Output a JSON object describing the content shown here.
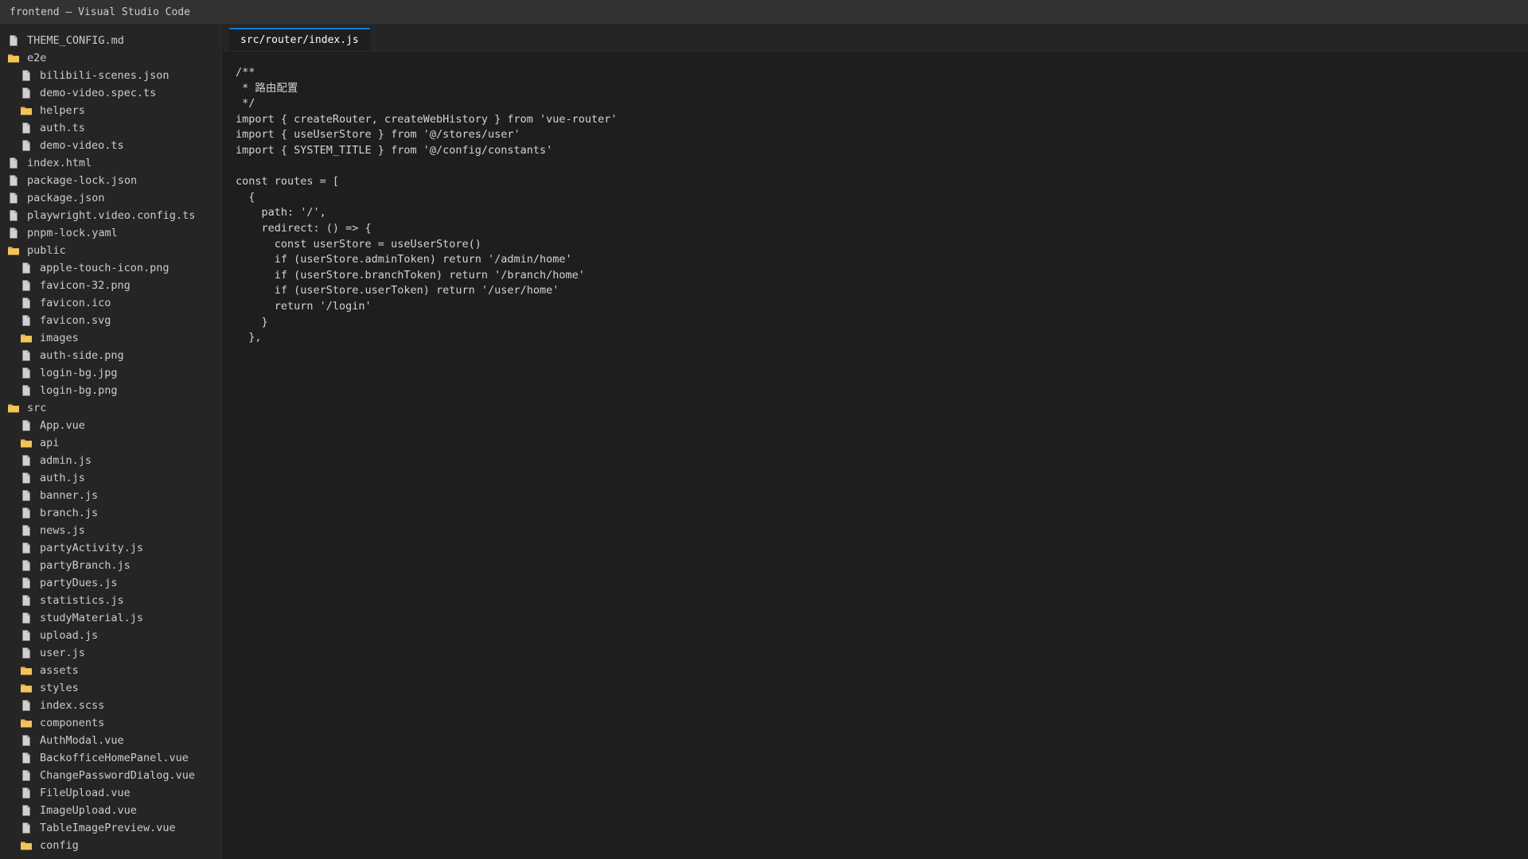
{
  "window": {
    "title": "frontend — Visual Studio Code"
  },
  "explorer": {
    "items": [
      {
        "label": "THEME_CONFIG.md",
        "type": "file",
        "depth": 0
      },
      {
        "label": "e2e",
        "type": "folder",
        "depth": 0
      },
      {
        "label": "bilibili-scenes.json",
        "type": "file",
        "depth": 1
      },
      {
        "label": "demo-video.spec.ts",
        "type": "file",
        "depth": 1
      },
      {
        "label": "helpers",
        "type": "folder",
        "depth": 1
      },
      {
        "label": "auth.ts",
        "type": "file",
        "depth": 1
      },
      {
        "label": "demo-video.ts",
        "type": "file",
        "depth": 1
      },
      {
        "label": "index.html",
        "type": "file",
        "depth": 0
      },
      {
        "label": "package-lock.json",
        "type": "file",
        "depth": 0
      },
      {
        "label": "package.json",
        "type": "file",
        "depth": 0
      },
      {
        "label": "playwright.video.config.ts",
        "type": "file",
        "depth": 0
      },
      {
        "label": "pnpm-lock.yaml",
        "type": "file",
        "depth": 0
      },
      {
        "label": "public",
        "type": "folder",
        "depth": 0
      },
      {
        "label": "apple-touch-icon.png",
        "type": "file",
        "depth": 1
      },
      {
        "label": "favicon-32.png",
        "type": "file",
        "depth": 1
      },
      {
        "label": "favicon.ico",
        "type": "file",
        "depth": 1
      },
      {
        "label": "favicon.svg",
        "type": "file",
        "depth": 1
      },
      {
        "label": "images",
        "type": "folder",
        "depth": 1
      },
      {
        "label": "auth-side.png",
        "type": "file",
        "depth": 1
      },
      {
        "label": "login-bg.jpg",
        "type": "file",
        "depth": 1
      },
      {
        "label": "login-bg.png",
        "type": "file",
        "depth": 1
      },
      {
        "label": "src",
        "type": "folder",
        "depth": 0
      },
      {
        "label": "App.vue",
        "type": "file",
        "depth": 1
      },
      {
        "label": "api",
        "type": "folder",
        "depth": 1
      },
      {
        "label": "admin.js",
        "type": "file",
        "depth": 1
      },
      {
        "label": "auth.js",
        "type": "file",
        "depth": 1
      },
      {
        "label": "banner.js",
        "type": "file",
        "depth": 1
      },
      {
        "label": "branch.js",
        "type": "file",
        "depth": 1
      },
      {
        "label": "news.js",
        "type": "file",
        "depth": 1
      },
      {
        "label": "partyActivity.js",
        "type": "file",
        "depth": 1
      },
      {
        "label": "partyBranch.js",
        "type": "file",
        "depth": 1
      },
      {
        "label": "partyDues.js",
        "type": "file",
        "depth": 1
      },
      {
        "label": "statistics.js",
        "type": "file",
        "depth": 1
      },
      {
        "label": "studyMaterial.js",
        "type": "file",
        "depth": 1
      },
      {
        "label": "upload.js",
        "type": "file",
        "depth": 1
      },
      {
        "label": "user.js",
        "type": "file",
        "depth": 1
      },
      {
        "label": "assets",
        "type": "folder",
        "depth": 1
      },
      {
        "label": "styles",
        "type": "folder",
        "depth": 1
      },
      {
        "label": "index.scss",
        "type": "file",
        "depth": 1
      },
      {
        "label": "components",
        "type": "folder",
        "depth": 1
      },
      {
        "label": "AuthModal.vue",
        "type": "file",
        "depth": 1
      },
      {
        "label": "BackofficeHomePanel.vue",
        "type": "file",
        "depth": 1
      },
      {
        "label": "ChangePasswordDialog.vue",
        "type": "file",
        "depth": 1
      },
      {
        "label": "FileUpload.vue",
        "type": "file",
        "depth": 1
      },
      {
        "label": "ImageUpload.vue",
        "type": "file",
        "depth": 1
      },
      {
        "label": "TableImagePreview.vue",
        "type": "file",
        "depth": 1
      },
      {
        "label": "config",
        "type": "folder",
        "depth": 1
      }
    ]
  },
  "editor": {
    "tabs": [
      {
        "label": "src/router/index.js",
        "active": true
      }
    ],
    "lines": [
      "/**",
      " * 路由配置",
      " */",
      "import { createRouter, createWebHistory } from 'vue-router'",
      "import { useUserStore } from '@/stores/user'",
      "import { SYSTEM_TITLE } from '@/config/constants'",
      "",
      "const routes = [",
      "  {",
      "    path: '/',",
      "    redirect: () => {",
      "      const userStore = useUserStore()",
      "      if (userStore.adminToken) return '/admin/home'",
      "      if (userStore.branchToken) return '/branch/home'",
      "      if (userStore.userToken) return '/user/home'",
      "      return '/login'",
      "    }",
      "  },"
    ]
  },
  "colors": {
    "folder_icon": "#e8b34b",
    "file_icon": "#d0d0d0",
    "tab_accent": "#0e7bd6"
  }
}
